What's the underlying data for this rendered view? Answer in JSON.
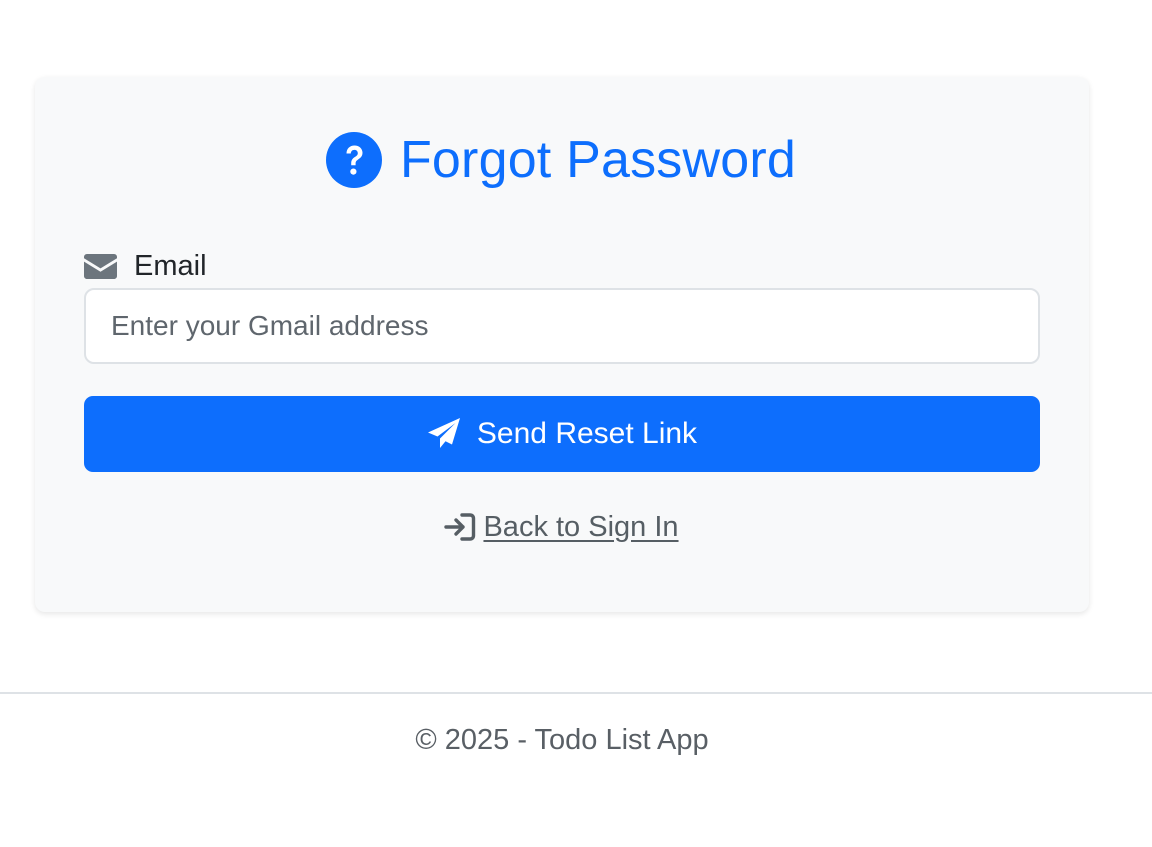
{
  "colors": {
    "accent": "#0d6efd",
    "card_background": "#f8f9fa",
    "muted_text": "#565e64",
    "icon_gray": "#6c757d"
  },
  "header": {
    "icon": "question-circle-icon",
    "title": "Forgot Password"
  },
  "form": {
    "email": {
      "icon": "envelope-icon",
      "label": "Email",
      "value": "",
      "placeholder": "Enter your Gmail address"
    },
    "submit": {
      "icon": "paper-plane-icon",
      "label": "Send Reset Link"
    },
    "back_link": {
      "icon": "sign-in-arrow-icon",
      "label": " Back to Sign In"
    }
  },
  "footer": {
    "text": "© 2025 - Todo List App"
  }
}
